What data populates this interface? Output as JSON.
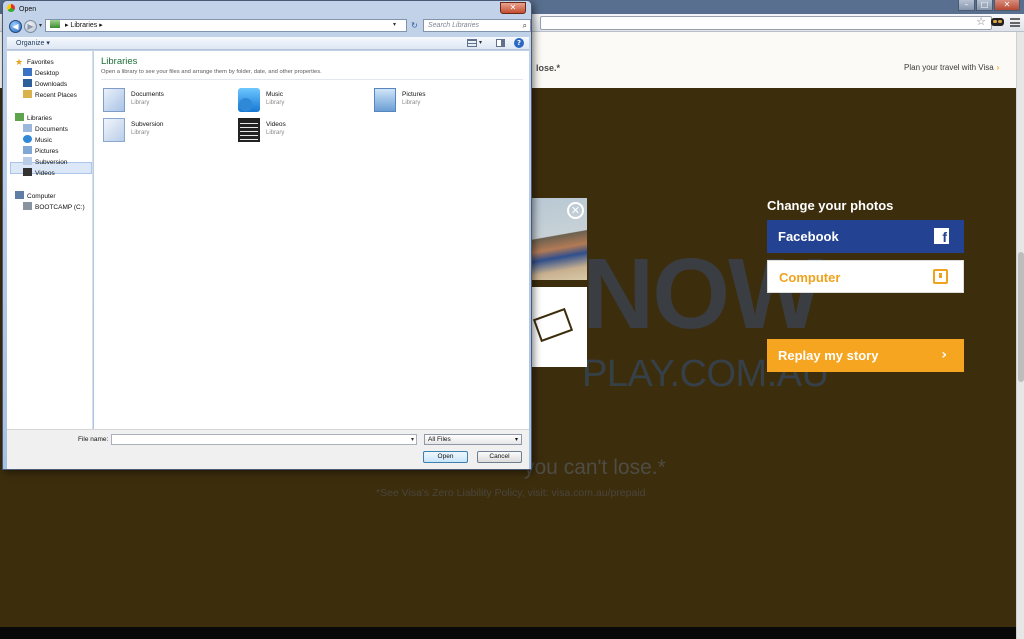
{
  "browser": {
    "window_buttons": [
      "–",
      "□",
      "✕"
    ]
  },
  "website": {
    "header_tagline": "lose.*",
    "plan_link": "Plan your travel with Visa",
    "plan_link_arrow": "›",
    "big_word": "NOW",
    "big_domain": "PLAY.COM.AU",
    "slogan": "you can't lose.*",
    "disclaimer": "*See Visa's Zero Liability Policy, visit: visa.com.au/prepaid",
    "change_title": "Change your photos",
    "facebook_label": "Facebook",
    "computer_label": "Computer",
    "replay_label": "Replay my story",
    "replay_chevron": "›",
    "colors": {
      "facebook": "#234292",
      "accent": "#f5a51f",
      "background": "#3c2d0d"
    }
  },
  "dialog": {
    "title": "Open",
    "close_label": "✕",
    "address_path": "Libraries",
    "address_arrow": "▸",
    "search_placeholder": "Search Libraries",
    "organize_label": "Organize ▾",
    "nav": {
      "favorites": "Favorites",
      "favorites_items": [
        "Desktop",
        "Downloads",
        "Recent Places"
      ],
      "libraries": "Libraries",
      "libraries_items": [
        "Documents",
        "Music",
        "Pictures",
        "Subversion",
        "Videos"
      ],
      "computer": "Computer",
      "computer_items": [
        "BOOTCAMP (C:)"
      ]
    },
    "content_title": "Libraries",
    "content_subtitle": "Open a library to see your files and arrange them by folder, date, and other properties.",
    "libraries": [
      {
        "name": "Documents",
        "type": "Library",
        "icon": "documents-library-icon"
      },
      {
        "name": "Music",
        "type": "Library",
        "icon": "music-library-icon"
      },
      {
        "name": "Pictures",
        "type": "Library",
        "icon": "pictures-library-icon"
      },
      {
        "name": "Subversion",
        "type": "Library",
        "icon": "subversion-library-icon"
      },
      {
        "name": "Videos",
        "type": "Library",
        "icon": "videos-library-icon"
      }
    ],
    "file_name_label": "File name:",
    "file_name_value": "",
    "file_type": "All Files",
    "open_label": "Open",
    "cancel_label": "Cancel"
  }
}
